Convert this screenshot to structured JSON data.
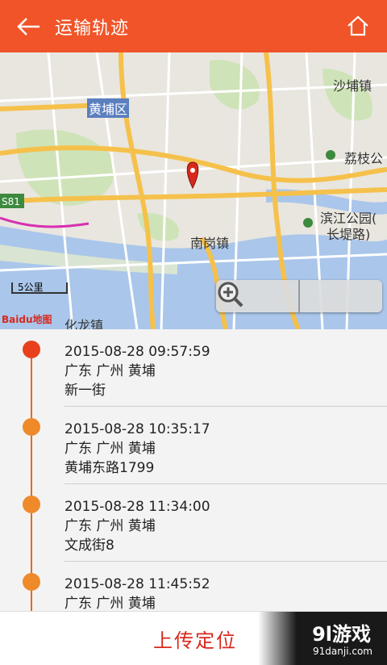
{
  "header": {
    "title": "运输轨迹",
    "back_icon": "arrow-left-icon",
    "home_icon": "home-icon",
    "bg_color": "#f05428"
  },
  "map": {
    "labels": {
      "huangpu_district": "黄埔区",
      "shabu": "沙埔镇",
      "lizhi": "荔枝公",
      "binjiang_park": "滨江公园(",
      "changdi_road": "长堤路)",
      "nangang": "南岗镇",
      "huanglong": "化龙镇",
      "s81": "S81"
    },
    "scale": "5公里",
    "baidu_logo": "Baidu地图",
    "zoom_out_icon": "zoom-out-icon",
    "zoom_in_icon": "zoom-in-icon",
    "marker_icon": "map-pin-icon"
  },
  "timeline": {
    "entries": [
      {
        "time": "2015-08-28 09:57:59",
        "region": "广东 广州 黄埔",
        "address": "新一街"
      },
      {
        "time": "2015-08-28 10:35:17",
        "region": "广东 广州 黄埔",
        "address": "黄埔东路1799"
      },
      {
        "time": "2015-08-28 11:34:00",
        "region": "广东 广州 黄埔",
        "address": "文成街8"
      },
      {
        "time": "2015-08-28 11:45:52",
        "region": "广东 广州 黄埔",
        "address": ""
      }
    ]
  },
  "bottom": {
    "upload_label": "上传定位"
  },
  "watermark": {
    "main": "9l游戏",
    "sub": "91danji.com"
  }
}
